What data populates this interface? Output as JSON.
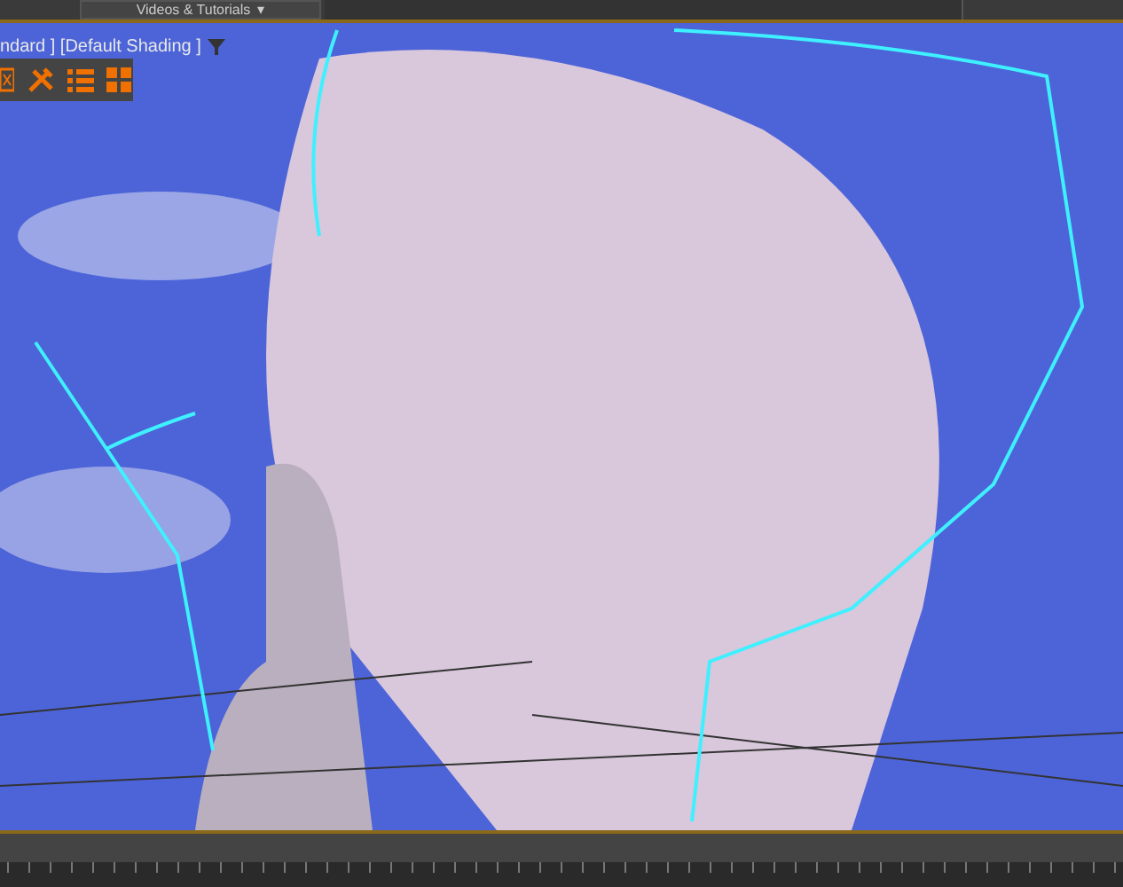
{
  "menu_bar": {
    "dropdown": {
      "label": "Videos & Tutorials",
      "caret": "▾"
    }
  },
  "viewport": {
    "label": "ndard ] [Default Shading ]",
    "toolbar": [
      {
        "kind": "frame"
      },
      {
        "kind": "tools"
      },
      {
        "kind": "list"
      },
      {
        "kind": "grid"
      }
    ]
  }
}
